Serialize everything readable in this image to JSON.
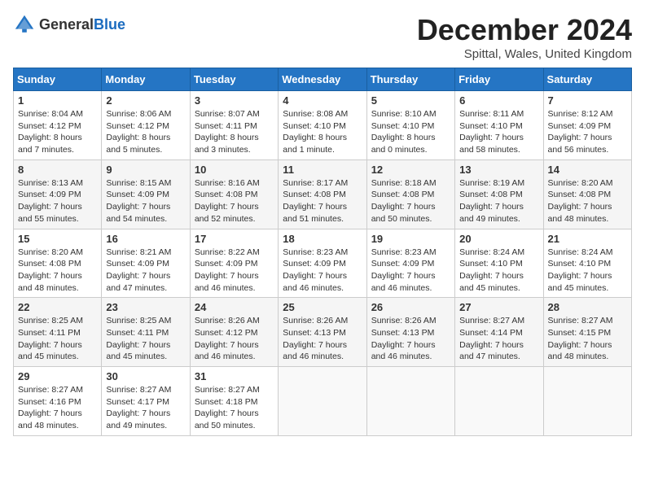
{
  "header": {
    "logo_general": "General",
    "logo_blue": "Blue",
    "month_title": "December 2024",
    "location": "Spittal, Wales, United Kingdom"
  },
  "days_of_week": [
    "Sunday",
    "Monday",
    "Tuesday",
    "Wednesday",
    "Thursday",
    "Friday",
    "Saturday"
  ],
  "weeks": [
    [
      {
        "day": "1",
        "lines": [
          "Sunrise: 8:04 AM",
          "Sunset: 4:12 PM",
          "Daylight: 8 hours",
          "and 7 minutes."
        ]
      },
      {
        "day": "2",
        "lines": [
          "Sunrise: 8:06 AM",
          "Sunset: 4:12 PM",
          "Daylight: 8 hours",
          "and 5 minutes."
        ]
      },
      {
        "day": "3",
        "lines": [
          "Sunrise: 8:07 AM",
          "Sunset: 4:11 PM",
          "Daylight: 8 hours",
          "and 3 minutes."
        ]
      },
      {
        "day": "4",
        "lines": [
          "Sunrise: 8:08 AM",
          "Sunset: 4:10 PM",
          "Daylight: 8 hours",
          "and 1 minute."
        ]
      },
      {
        "day": "5",
        "lines": [
          "Sunrise: 8:10 AM",
          "Sunset: 4:10 PM",
          "Daylight: 8 hours",
          "and 0 minutes."
        ]
      },
      {
        "day": "6",
        "lines": [
          "Sunrise: 8:11 AM",
          "Sunset: 4:10 PM",
          "Daylight: 7 hours",
          "and 58 minutes."
        ]
      },
      {
        "day": "7",
        "lines": [
          "Sunrise: 8:12 AM",
          "Sunset: 4:09 PM",
          "Daylight: 7 hours",
          "and 56 minutes."
        ]
      }
    ],
    [
      {
        "day": "8",
        "lines": [
          "Sunrise: 8:13 AM",
          "Sunset: 4:09 PM",
          "Daylight: 7 hours",
          "and 55 minutes."
        ]
      },
      {
        "day": "9",
        "lines": [
          "Sunrise: 8:15 AM",
          "Sunset: 4:09 PM",
          "Daylight: 7 hours",
          "and 54 minutes."
        ]
      },
      {
        "day": "10",
        "lines": [
          "Sunrise: 8:16 AM",
          "Sunset: 4:08 PM",
          "Daylight: 7 hours",
          "and 52 minutes."
        ]
      },
      {
        "day": "11",
        "lines": [
          "Sunrise: 8:17 AM",
          "Sunset: 4:08 PM",
          "Daylight: 7 hours",
          "and 51 minutes."
        ]
      },
      {
        "day": "12",
        "lines": [
          "Sunrise: 8:18 AM",
          "Sunset: 4:08 PM",
          "Daylight: 7 hours",
          "and 50 minutes."
        ]
      },
      {
        "day": "13",
        "lines": [
          "Sunrise: 8:19 AM",
          "Sunset: 4:08 PM",
          "Daylight: 7 hours",
          "and 49 minutes."
        ]
      },
      {
        "day": "14",
        "lines": [
          "Sunrise: 8:20 AM",
          "Sunset: 4:08 PM",
          "Daylight: 7 hours",
          "and 48 minutes."
        ]
      }
    ],
    [
      {
        "day": "15",
        "lines": [
          "Sunrise: 8:20 AM",
          "Sunset: 4:08 PM",
          "Daylight: 7 hours",
          "and 48 minutes."
        ]
      },
      {
        "day": "16",
        "lines": [
          "Sunrise: 8:21 AM",
          "Sunset: 4:09 PM",
          "Daylight: 7 hours",
          "and 47 minutes."
        ]
      },
      {
        "day": "17",
        "lines": [
          "Sunrise: 8:22 AM",
          "Sunset: 4:09 PM",
          "Daylight: 7 hours",
          "and 46 minutes."
        ]
      },
      {
        "day": "18",
        "lines": [
          "Sunrise: 8:23 AM",
          "Sunset: 4:09 PM",
          "Daylight: 7 hours",
          "and 46 minutes."
        ]
      },
      {
        "day": "19",
        "lines": [
          "Sunrise: 8:23 AM",
          "Sunset: 4:09 PM",
          "Daylight: 7 hours",
          "and 46 minutes."
        ]
      },
      {
        "day": "20",
        "lines": [
          "Sunrise: 8:24 AM",
          "Sunset: 4:10 PM",
          "Daylight: 7 hours",
          "and 45 minutes."
        ]
      },
      {
        "day": "21",
        "lines": [
          "Sunrise: 8:24 AM",
          "Sunset: 4:10 PM",
          "Daylight: 7 hours",
          "and 45 minutes."
        ]
      }
    ],
    [
      {
        "day": "22",
        "lines": [
          "Sunrise: 8:25 AM",
          "Sunset: 4:11 PM",
          "Daylight: 7 hours",
          "and 45 minutes."
        ]
      },
      {
        "day": "23",
        "lines": [
          "Sunrise: 8:25 AM",
          "Sunset: 4:11 PM",
          "Daylight: 7 hours",
          "and 45 minutes."
        ]
      },
      {
        "day": "24",
        "lines": [
          "Sunrise: 8:26 AM",
          "Sunset: 4:12 PM",
          "Daylight: 7 hours",
          "and 46 minutes."
        ]
      },
      {
        "day": "25",
        "lines": [
          "Sunrise: 8:26 AM",
          "Sunset: 4:13 PM",
          "Daylight: 7 hours",
          "and 46 minutes."
        ]
      },
      {
        "day": "26",
        "lines": [
          "Sunrise: 8:26 AM",
          "Sunset: 4:13 PM",
          "Daylight: 7 hours",
          "and 46 minutes."
        ]
      },
      {
        "day": "27",
        "lines": [
          "Sunrise: 8:27 AM",
          "Sunset: 4:14 PM",
          "Daylight: 7 hours",
          "and 47 minutes."
        ]
      },
      {
        "day": "28",
        "lines": [
          "Sunrise: 8:27 AM",
          "Sunset: 4:15 PM",
          "Daylight: 7 hours",
          "and 48 minutes."
        ]
      }
    ],
    [
      {
        "day": "29",
        "lines": [
          "Sunrise: 8:27 AM",
          "Sunset: 4:16 PM",
          "Daylight: 7 hours",
          "and 48 minutes."
        ]
      },
      {
        "day": "30",
        "lines": [
          "Sunrise: 8:27 AM",
          "Sunset: 4:17 PM",
          "Daylight: 7 hours",
          "and 49 minutes."
        ]
      },
      {
        "day": "31",
        "lines": [
          "Sunrise: 8:27 AM",
          "Sunset: 4:18 PM",
          "Daylight: 7 hours",
          "and 50 minutes."
        ]
      },
      null,
      null,
      null,
      null
    ]
  ]
}
